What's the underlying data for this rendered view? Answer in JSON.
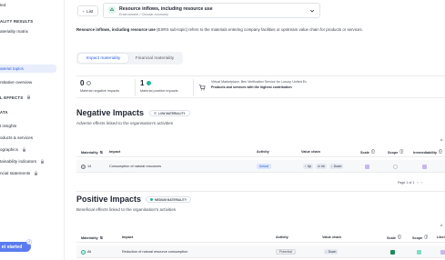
{
  "sidebar": {
    "top_item": "ted",
    "section_results": "ALITY RESULTS",
    "items_results": [
      "ateriality matrix",
      "aterial topics",
      "ntitative overview"
    ],
    "section_effects": "L EFFECTS",
    "section_data": "ATA",
    "items_data": [
      "t insights",
      "oducts & services",
      "ographics",
      "tainability indicators",
      "ncial statements"
    ],
    "get_started": "et started",
    "get_started_badge": "4"
  },
  "topbar": {
    "back_label": "List",
    "topic_title": "Resource inflows, including resource use",
    "topic_subtitle": "Environment / Circular economy"
  },
  "description": {
    "bold": "Resource inflows, including resource use",
    "rest": " (ESRS sub-topic) refers to the materials entering company facilities or upstream value chain for products or services."
  },
  "tabs": [
    "Impact materiality",
    "Financial materiality"
  ],
  "stats": {
    "negative_count": "0",
    "negative_label": "Material negative impacts",
    "positive_count": "1",
    "positive_label": "Material positive impacts",
    "value_chain_line1": "Virtual Marketplace, Ben Verification Service for Luxury, United Ec",
    "value_chain_line2": "Products and services with the highest contribution"
  },
  "negative": {
    "title": "Negative Impacts",
    "badge": "LOW MATERIALITY",
    "subtitle": "Adverse effects linked to the organisation's activities",
    "headers": [
      "Materiality",
      "Impact",
      "Activity",
      "Value chain",
      "Scale",
      "Scope",
      "Irremediability"
    ],
    "overflow_label": "A",
    "rows": [
      {
        "id": "14",
        "impact": "Consumption of natural resources",
        "activity": "Actual",
        "chain": [
          "Up",
          "Int",
          "Down"
        ]
      }
    ],
    "pager": "Page 1 of 1"
  },
  "positive": {
    "title": "Positive Impacts",
    "badge": "MEDIUM MATERIALITY",
    "subtitle": "Beneficial effects linked to the organisation's activities",
    "headers": [
      "Materiality",
      "Impact",
      "Activity",
      "Value chain",
      "Scale",
      "Scope",
      "Likel"
    ],
    "overflow_label": "A",
    "rows": [
      {
        "id": "All",
        "impact": "Reduction of natural resource consumption",
        "activity": "Potential",
        "chain": [
          "Down"
        ]
      }
    ]
  },
  "colors": {
    "accent": "#2d5fe0",
    "button": "#5b7cf0",
    "teal": "#23b59a",
    "scale_purple": "#c7b6f0",
    "scale_green": "#1f8a5c",
    "scope_green": "#7fe0c0"
  }
}
